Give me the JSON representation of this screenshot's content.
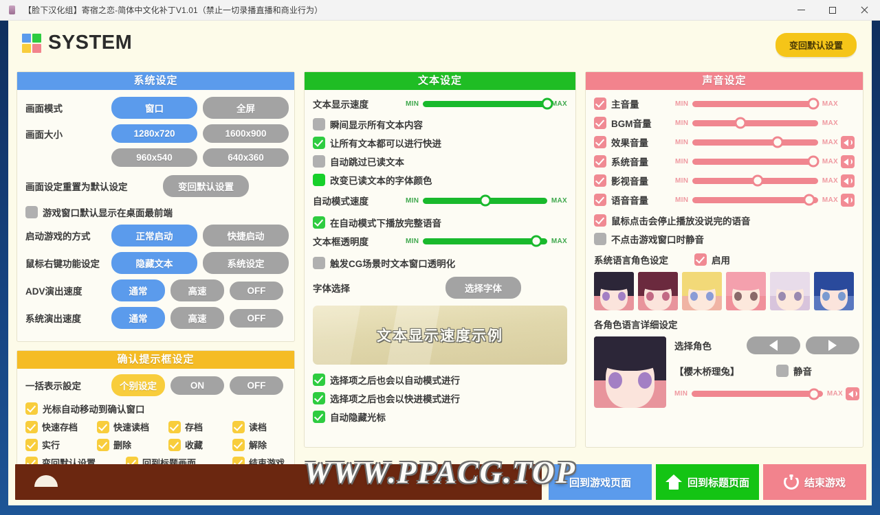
{
  "window": {
    "title": "【脸下汉化组】寄宿之恋-简体中文化补丁V1.01（禁止一切录播直播和商业行为）",
    "minimize": "—",
    "maximize": "□",
    "close": "✕"
  },
  "header": {
    "title": "SYSTEM",
    "reset_all_label": "变回默认设置",
    "logo_colors": [
      "#5b9bec",
      "#2ecc40",
      "#f8cd3c",
      "#f2838d"
    ]
  },
  "colors": {
    "system_header": "#5b9bec",
    "text_header": "#1fbd24",
    "voice_header": "#f2838d",
    "confirm_header": "#f5bc25",
    "off_button": "#a3a3a3",
    "page_bg": "#fdfbe9"
  },
  "system_panel": {
    "header": "系统设定",
    "rows": [
      {
        "label": "画面模式",
        "options": [
          {
            "label": "窗口",
            "state": "on-blue"
          },
          {
            "label": "全屏",
            "state": "off"
          }
        ]
      },
      {
        "label": "画面大小",
        "options": [
          {
            "label": "1280x720",
            "state": "on-blue"
          },
          {
            "label": "1600x900",
            "state": "off"
          }
        ]
      },
      {
        "label": "",
        "options": [
          {
            "label": "960x540",
            "state": "off"
          },
          {
            "label": "640x360",
            "state": "off"
          }
        ]
      }
    ],
    "reset_row": {
      "label": "画面设定重置为默认设定",
      "button": "变回默认设置"
    },
    "topmost_checkbox": {
      "label": "游戏窗口默认显示在桌面最前端",
      "checked": false
    },
    "rows2": [
      {
        "label": "启动游戏的方式",
        "options": [
          {
            "label": "正常启动",
            "state": "on-blue"
          },
          {
            "label": "快捷启动",
            "state": "off"
          }
        ]
      },
      {
        "label": "鼠标右键功能设定",
        "options": [
          {
            "label": "隐藏文本",
            "state": "on-blue"
          },
          {
            "label": "系统设定",
            "state": "off"
          }
        ]
      },
      {
        "label": "ADV演出速度",
        "options": [
          {
            "label": "通常",
            "state": "on-blue"
          },
          {
            "label": "高速",
            "state": "off"
          },
          {
            "label": "OFF",
            "state": "off"
          }
        ]
      },
      {
        "label": "系统演出速度",
        "options": [
          {
            "label": "通常",
            "state": "on-blue"
          },
          {
            "label": "高速",
            "state": "off"
          },
          {
            "label": "OFF",
            "state": "off"
          }
        ]
      }
    ]
  },
  "confirm_panel": {
    "header": "确认提示框设定",
    "bulk_row": {
      "label": "一括表示設定",
      "options": [
        {
          "label": "个别设定",
          "state": "on-yellow"
        },
        {
          "label": "ON",
          "state": "off"
        },
        {
          "label": "OFF",
          "state": "off"
        }
      ]
    },
    "cursor_checkbox": {
      "label": "光标自动移动到确认窗口",
      "checked": true
    },
    "grid": [
      [
        {
          "label": "快速存档",
          "checked": true
        },
        {
          "label": "快速读档",
          "checked": true
        },
        {
          "label": "存档",
          "checked": true
        },
        {
          "label": "读档",
          "checked": true
        }
      ],
      [
        {
          "label": "实行",
          "checked": true
        },
        {
          "label": "删除",
          "checked": true
        },
        {
          "label": "收藏",
          "checked": true
        },
        {
          "label": "解除",
          "checked": true
        }
      ],
      [
        {
          "label": "变回默认设置",
          "checked": true
        },
        {
          "label": "回到标题画面",
          "checked": true
        },
        {
          "label": "结束游戏",
          "checked": true
        }
      ]
    ]
  },
  "text_panel": {
    "header": "文本设定",
    "speed_slider": {
      "label": "文本显示速度",
      "min": "MIN",
      "max": "MAX",
      "value": 100
    },
    "checkboxes_top": [
      {
        "label": "瞬间显示所有文本内容",
        "checked": false,
        "style": "gray"
      },
      {
        "label": "让所有文本都可以进行快进",
        "checked": true,
        "style": "check"
      },
      {
        "label": "自动跳过已读文本",
        "checked": false,
        "style": "gray"
      },
      {
        "label": "改变已读文本的字体颜色",
        "checked": true,
        "style": "solid"
      }
    ],
    "auto_speed_slider": {
      "label": "自动模式速度",
      "min": "MIN",
      "max": "MAX",
      "value": 50
    },
    "voice_full_checkbox": {
      "label": "在自动模式下播放完整语音",
      "checked": true
    },
    "opacity_slider": {
      "label": "文本框透明度",
      "min": "MIN",
      "max": "MAX",
      "value": 91
    },
    "cg_checkbox": {
      "label": "触发CG场景时文本窗口透明化",
      "checked": false
    },
    "font_row": {
      "label": "字体选择",
      "button": "选择字体"
    },
    "preview_text": "文本显示速度示例",
    "checkboxes_bottom": [
      {
        "label": "选择项之后也会以自动模式进行",
        "checked": true
      },
      {
        "label": "选择项之后也会以快进模式进行",
        "checked": true
      },
      {
        "label": "自动隐藏光标",
        "checked": true
      }
    ]
  },
  "voice_panel": {
    "header": "声音设定",
    "volumes": [
      {
        "label": "主音量",
        "checked": true,
        "value": 96,
        "speaker": false
      },
      {
        "label": "BGM音量",
        "checked": true,
        "value": 38,
        "speaker": false
      },
      {
        "label": "效果音量",
        "checked": true,
        "value": 68,
        "speaker": true
      },
      {
        "label": "系统音量",
        "checked": true,
        "value": 96,
        "speaker": true
      },
      {
        "label": "影视音量",
        "checked": true,
        "value": 52,
        "speaker": true
      },
      {
        "label": "语音音量",
        "checked": true,
        "value": 93,
        "speaker": true
      }
    ],
    "stop_voice_checkbox": {
      "label": "鼠标点击会停止播放没说完的语音",
      "checked": true
    },
    "mute_unfocused_checkbox": {
      "label": "不点击游戏窗口时静音",
      "checked": false
    },
    "sys_lang_row": {
      "label": "系统语言角色设定",
      "enable_label": "启用",
      "checked": true
    },
    "character_thumbs": [
      {
        "name": "character-1",
        "hair": "#2c2638",
        "eye": "#a37fc4",
        "skin": "#fbe4dc",
        "bg": "#e8949c"
      },
      {
        "name": "character-2",
        "hair": "#6b2a3e",
        "eye": "#c26a84",
        "skin": "#fbe4dc",
        "bg": "#e8949c"
      },
      {
        "name": "character-3",
        "hair": "#f2d978",
        "eye": "#8b9cd6",
        "skin": "#fce8dc",
        "bg": "#f0b4a4"
      },
      {
        "name": "character-4",
        "hair": "#f4a0ad",
        "eye": "#8a6a6a",
        "skin": "#fce8dc",
        "bg": "#f0909a"
      },
      {
        "name": "character-5",
        "hair": "#e8dcea",
        "eye": "#9a8ab0",
        "skin": "#fce8dc",
        "bg": "#d8c4dc"
      },
      {
        "name": "character-6",
        "hair": "#2a4a9c",
        "eye": "#7a9ad0",
        "skin": "#fbe4dc",
        "bg": "#5a78c0"
      }
    ],
    "detail_label": "各角色语言详细设定",
    "select_char_label": "选择角色",
    "prev_label": "◀",
    "next_label": "▶",
    "current_character": "【樱木桥理兔】",
    "mute_label": "静音",
    "mute_checked": false,
    "char_volume": {
      "min": "MIN",
      "max": "MAX",
      "value": 93
    }
  },
  "bottom_bar": {
    "buttons": [
      {
        "label": "回到游戏页面",
        "color": "blue",
        "icon": "none"
      },
      {
        "label": "回到标题页面",
        "color": "green",
        "icon": "home-icon"
      },
      {
        "label": "结束游戏",
        "color": "red",
        "icon": "power-icon"
      }
    ]
  },
  "watermark": {
    "text": "WWW.PPACG.TOP"
  }
}
